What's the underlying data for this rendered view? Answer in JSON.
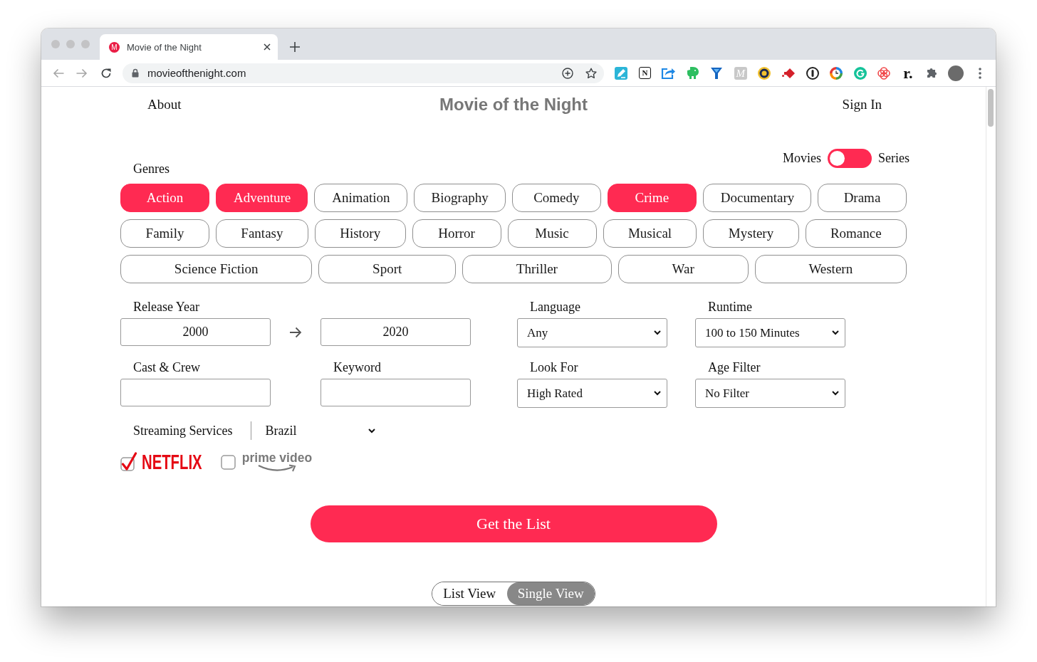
{
  "browser": {
    "tab": {
      "favicon_letter": "M",
      "title": "Movie of the Night"
    },
    "url": "movieofthenight.com",
    "extension_glyphs": [
      "N",
      "M",
      "r."
    ]
  },
  "header": {
    "about": "About",
    "title": "Movie of the Night",
    "sign_in": "Sign In"
  },
  "content_type": {
    "left_label": "Movies",
    "right_label": "Series",
    "on": false
  },
  "genres": {
    "label": "Genres",
    "rows": [
      [
        {
          "label": "Action",
          "selected": true
        },
        {
          "label": "Adventure",
          "selected": true
        },
        {
          "label": "Animation",
          "selected": false
        },
        {
          "label": "Biography",
          "selected": false
        },
        {
          "label": "Comedy",
          "selected": false
        },
        {
          "label": "Crime",
          "selected": true
        },
        {
          "label": "Documentary",
          "selected": false
        },
        {
          "label": "Drama",
          "selected": false
        }
      ],
      [
        {
          "label": "Family",
          "selected": false
        },
        {
          "label": "Fantasy",
          "selected": false
        },
        {
          "label": "History",
          "selected": false
        },
        {
          "label": "Horror",
          "selected": false
        },
        {
          "label": "Music",
          "selected": false
        },
        {
          "label": "Musical",
          "selected": false
        },
        {
          "label": "Mystery",
          "selected": false
        },
        {
          "label": "Romance",
          "selected": false
        }
      ],
      [
        {
          "label": "Science Fiction",
          "selected": false
        },
        {
          "label": "Sport",
          "selected": false
        },
        {
          "label": "Thriller",
          "selected": false
        },
        {
          "label": "War",
          "selected": false
        },
        {
          "label": "Western",
          "selected": false
        }
      ]
    ]
  },
  "filters": {
    "release_year": {
      "label": "Release Year",
      "from": "2000",
      "to": "2020"
    },
    "language": {
      "label": "Language",
      "value": "Any"
    },
    "runtime": {
      "label": "Runtime",
      "value": "100 to 150 Minutes"
    },
    "cast_crew": {
      "label": "Cast & Crew"
    },
    "keyword": {
      "label": "Keyword"
    },
    "look_for": {
      "label": "Look For",
      "value": "High Rated"
    },
    "age_filter": {
      "label": "Age Filter",
      "value": "No Filter"
    }
  },
  "streaming": {
    "label": "Streaming Services",
    "country": "Brazil",
    "services": [
      {
        "kind": "netflix",
        "name": "NETFLIX",
        "checked": true
      },
      {
        "kind": "prime",
        "name": "prime video",
        "checked": false
      }
    ]
  },
  "submit": "Get the List",
  "view_toggle": [
    {
      "label": "List View",
      "selected": false
    },
    {
      "label": "Single View",
      "selected": true
    }
  ]
}
